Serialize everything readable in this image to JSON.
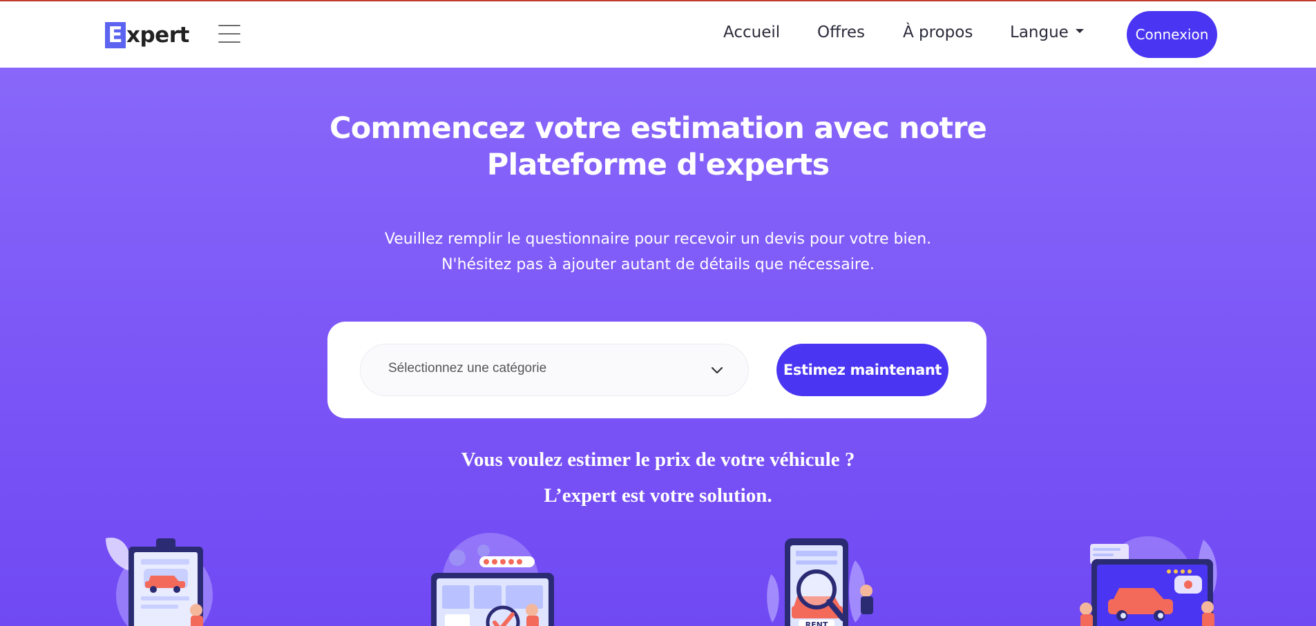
{
  "navbar": {
    "logo_letter": "E",
    "logo_rest": "xpert",
    "menu_icon": "hamburger-menu-icon",
    "links": [
      "Accueil",
      "Offres",
      "À propos",
      "Langue"
    ],
    "login_label": "Connexion"
  },
  "hero": {
    "title_line1": "Commencez votre estimation avec notre",
    "title_line2": "Plateforme d'experts",
    "subtitle_line1": "Veuillez remplir le questionnaire pour recevoir un devis pour votre bien.",
    "subtitle_line2": "N'hésitez pas à ajouter autant de détails que nécessaire."
  },
  "search": {
    "select_placeholder": "Sélectionnez une catégorie",
    "button_label": "Estimez maintenant"
  },
  "tagline": {
    "line1": "Vous voulez estimer le prix de votre véhicule ?",
    "line2": "L’expert est votre solution."
  },
  "illustrations": {
    "rent_label": "RENT"
  },
  "colors": {
    "accent": "#4a36f2",
    "hero_bg": "#7b55f6",
    "car": "#f36a5a"
  }
}
